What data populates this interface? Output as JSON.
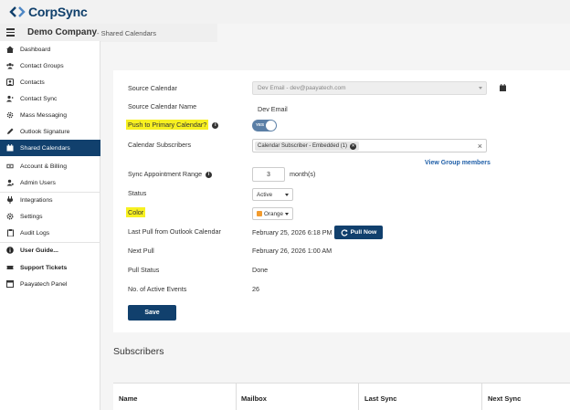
{
  "brand": {
    "name": "CorpSync"
  },
  "header": {
    "company": "Demo Company",
    "breadcrumb": "- Shared Calendars"
  },
  "sidebar": {
    "items": [
      {
        "label": "Dashboard",
        "icon": "home-icon"
      },
      {
        "label": "Contact Groups",
        "icon": "users-icon"
      },
      {
        "label": "Contacts",
        "icon": "contact-icon"
      },
      {
        "label": "Contact Sync",
        "icon": "contact-sync-icon"
      },
      {
        "label": "Mass Messaging",
        "icon": "gear-icon"
      },
      {
        "label": "Outlook Signature",
        "icon": "pen-icon"
      },
      {
        "label": "Shared Calendars",
        "icon": "calendar-icon"
      },
      {
        "label": "Account & Billing",
        "icon": "billing-icon"
      },
      {
        "label": "Admin Users",
        "icon": "admin-icon"
      },
      {
        "label": "Integrations",
        "icon": "plug-icon"
      },
      {
        "label": "Settings",
        "icon": "settings-icon"
      },
      {
        "label": "Audit Logs",
        "icon": "clipboard-icon"
      },
      {
        "label": "User Guide...",
        "icon": "info-icon"
      },
      {
        "label": "Support Tickets",
        "icon": "ticket-icon"
      },
      {
        "label": "Paayatech Panel",
        "icon": "panel-icon"
      }
    ]
  },
  "form": {
    "source_calendar_label": "Source Calendar",
    "source_calendar_value": "Dev Email - dev@paayatech.com",
    "source_calendar_name_label": "Source Calendar Name",
    "source_calendar_name_value": "Dev Email",
    "push_label": "Push to Primary Calendar?",
    "push_toggle_text": "YES",
    "subscribers_label": "Calendar Subscribers",
    "subscriber_tag": "Calendar Subscriber - Embedded (1)",
    "view_group_members": "View Group members",
    "sync_range_label": "Sync Appointment Range",
    "sync_range_value": "3",
    "sync_range_unit": "month(s)",
    "status_label": "Status",
    "status_value": "Active",
    "color_label": "Color",
    "color_value": "Orange",
    "color_swatch": "#f29b2e",
    "last_pull_label": "Last Pull from Outlook Calendar",
    "last_pull_value": "February 25, 2026 6:18 PM",
    "pull_now": "Pull Now",
    "next_pull_label": "Next Pull",
    "next_pull_value": "February 26, 2026 1:00 AM",
    "pull_status_label": "Pull Status",
    "pull_status_value": "Done",
    "active_events_label": "No. of Active Events",
    "active_events_value": "26",
    "save": "Save"
  },
  "subscribers": {
    "title": "Subscribers",
    "columns": [
      "Name",
      "Mailbox",
      "Last Sync",
      "Next Sync"
    ]
  },
  "colors": {
    "primary": "#11406d",
    "highlight": "#f7f021",
    "link": "#1f5fa8"
  }
}
